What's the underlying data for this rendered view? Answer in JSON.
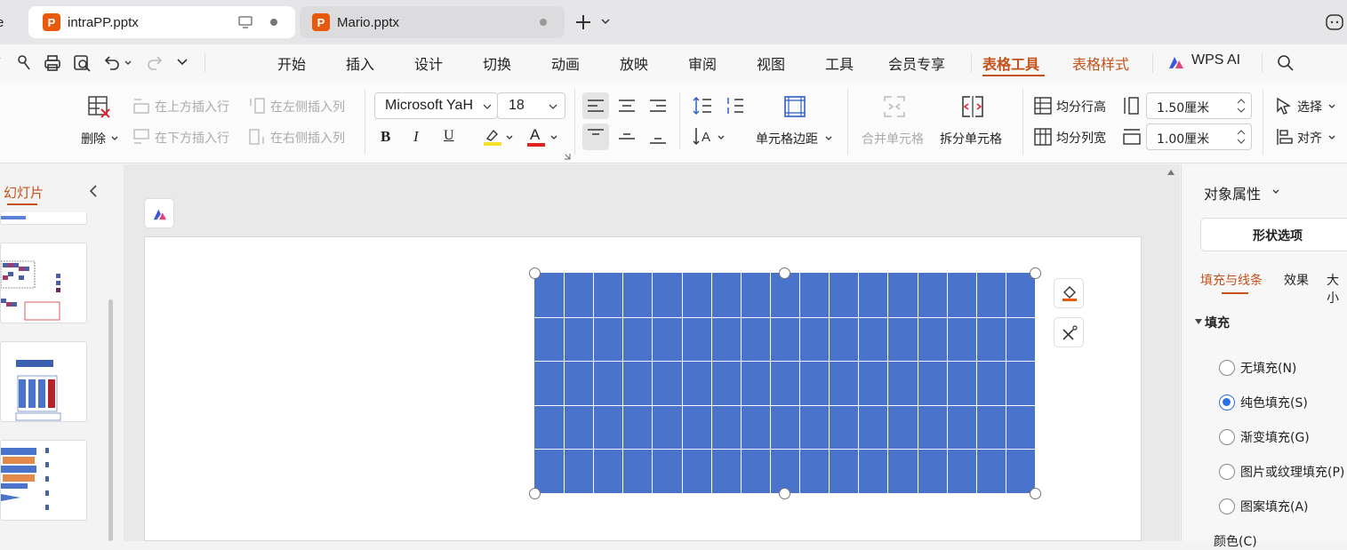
{
  "tabs": [
    {
      "label": "e"
    },
    {
      "label": "intraPP.pptx",
      "logo": "P"
    },
    {
      "label": "Mario.pptx",
      "logo": "P"
    }
  ],
  "menu": {
    "items": [
      "开始",
      "插入",
      "设计",
      "切换",
      "动画",
      "放映",
      "审阅",
      "视图",
      "工具",
      "会员专享",
      "表格工具",
      "表格样式",
      "WPS AI"
    ],
    "active": "表格工具"
  },
  "ribbon": {
    "delete_label": "删除",
    "insert_row_above": "在上方插入行",
    "insert_row_below": "在下方插入行",
    "insert_col_left": "在左侧插入列",
    "insert_col_right": "在右侧插入列",
    "font_name": "Microsoft YaH",
    "font_size": "18",
    "bold": "B",
    "italic": "I",
    "underline": "U",
    "font_color_glyph": "A",
    "cell_margin": "单元格边距",
    "merge_cells": "合并单元格",
    "split_cells": "拆分单元格",
    "equal_row_height": "均分行高",
    "equal_col_width": "均分列宽",
    "row_height_value": "1.50厘米",
    "col_width_value": "1.00厘米",
    "select": "选择",
    "align": "对齐"
  },
  "left_panel": {
    "title": "幻灯片"
  },
  "right_panel": {
    "title": "对象属性",
    "shape_options": "形状选项",
    "subtabs": [
      "填充与线条",
      "效果",
      "大小"
    ],
    "section": "填充",
    "fill_options": [
      {
        "label": "无填充(N)",
        "selected": false
      },
      {
        "label": "纯色填充(S)",
        "selected": true
      },
      {
        "label": "渐变填充(G)",
        "selected": false
      },
      {
        "label": "图片或纹理填充(P)",
        "selected": false
      },
      {
        "label": "图案填充(A)",
        "selected": false
      }
    ],
    "cut_label": "颜色(C)"
  },
  "table": {
    "rows": 5,
    "cols": 17,
    "fill_color": "#4a74cb",
    "line_color": "#ffffff"
  },
  "colors": {
    "accent": "#c4501a",
    "radio": "#2f6fe4",
    "logo": "#e8590c"
  }
}
